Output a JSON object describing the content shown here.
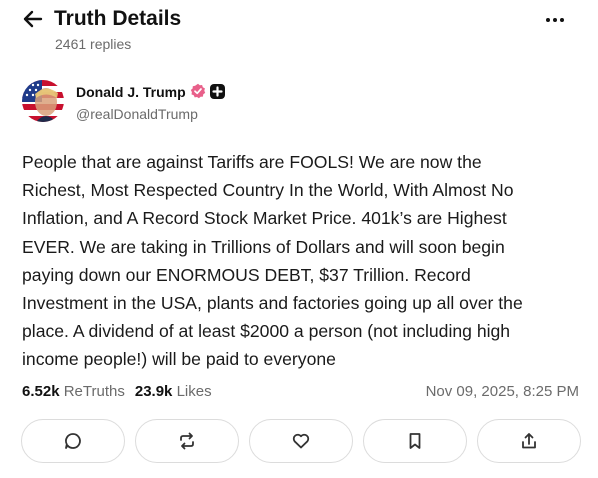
{
  "header": {
    "back_icon": "arrow-left-icon",
    "title": "Truth Details",
    "replies": "2461 replies",
    "more_icon": "more-horizontal-icon"
  },
  "author": {
    "name": "Donald J. Trump",
    "handle": "@realDonaldTrump",
    "avatar_icon": "avatar-flag-portrait",
    "verified_icon": "verified-badge-icon",
    "badge_icon": "plus-badge-icon",
    "verified_color": "#e8608a"
  },
  "post": {
    "text": "People that are against Tariffs are FOOLS! We are now the\nRichest, Most Respected Country In the World, With Almost No\nInflation, and A Record Stock Market Price. 401k’s are Highest\nEVER. We are taking in Trillions of Dollars and will soon begin\npaying down our ENORMOUS DEBT, $37 Trillion. Record\nInvestment in the USA, plants and factories going up all over the\nplace. A dividend of at least $2000 a person (not including high\nincome people!) will be paid to everyone"
  },
  "stats": {
    "retruths_count": "6.52k",
    "retruths_label": "ReTruths",
    "likes_count": "23.9k",
    "likes_label": "Likes",
    "timestamp": "Nov 09, 2025, 8:25 PM"
  },
  "actions": [
    {
      "icon": "comment-icon"
    },
    {
      "icon": "retruth-icon"
    },
    {
      "icon": "heart-icon"
    },
    {
      "icon": "bookmark-icon"
    },
    {
      "icon": "share-icon"
    }
  ]
}
